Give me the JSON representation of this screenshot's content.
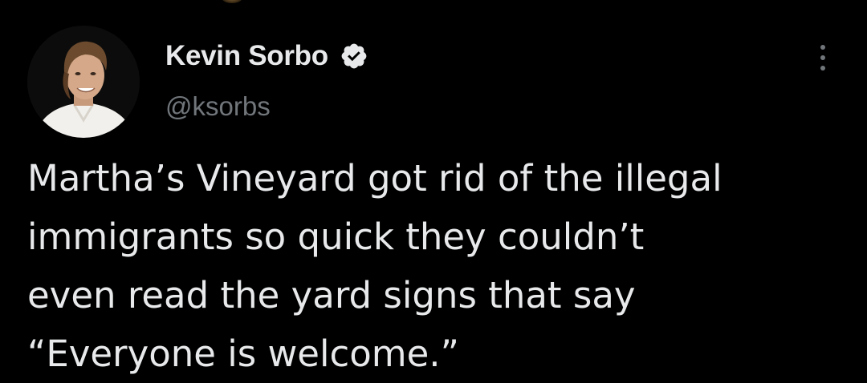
{
  "tweet": {
    "author": {
      "name": "Kevin Sorbo",
      "handle": "@ksorbs",
      "verified": true,
      "avatar_icon": "profile-photo"
    },
    "text_lines": [
      "Martha’s Vineyard got rid of the illegal",
      "immigrants so quick they couldn’t",
      "even read the yard signs that say",
      "“Everyone is welcome.”"
    ],
    "more_icon": "more-options-icon"
  },
  "colors": {
    "background": "#000000",
    "text_primary": "#e7e9ea",
    "text_secondary": "#71767b",
    "verified_badge": "#e7e9ea"
  }
}
